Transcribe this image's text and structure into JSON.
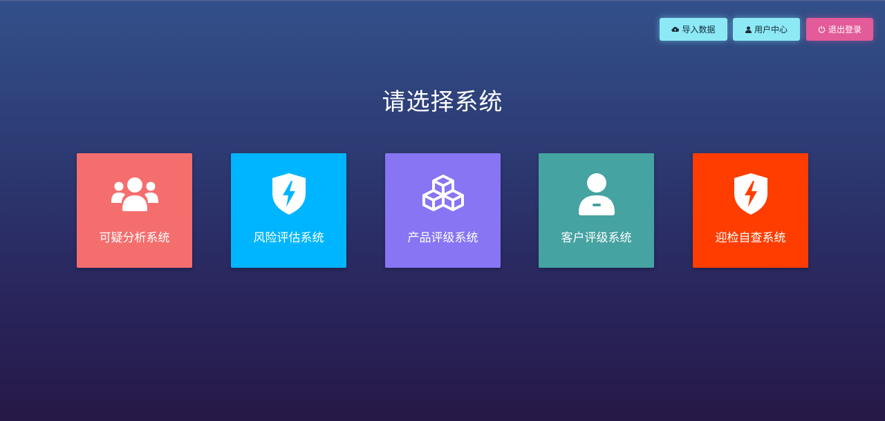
{
  "toolbar": {
    "import_label": "导入数据",
    "user_center_label": "用户中心",
    "logout_label": "退出登录"
  },
  "title": "请选择系统",
  "systems": [
    {
      "label": "可疑分析系统",
      "icon": "users-group-icon",
      "color": "#f56e6e"
    },
    {
      "label": "风险评估系统",
      "icon": "shield-bolt-icon",
      "color": "#00b5ff"
    },
    {
      "label": "产品评级系统",
      "icon": "cubes-icon",
      "color": "#8775f3"
    },
    {
      "label": "客户评级系统",
      "icon": "user-badge-icon",
      "color": "#45a3a1"
    },
    {
      "label": "迎检自查系统",
      "icon": "shield-bolt-icon",
      "color": "#ff3d00"
    }
  ],
  "colors": {
    "accent_cyan": "#8de9f5",
    "logout_pink": "#e35b98",
    "background_top": "#33508a",
    "background_bottom": "#261847"
  }
}
